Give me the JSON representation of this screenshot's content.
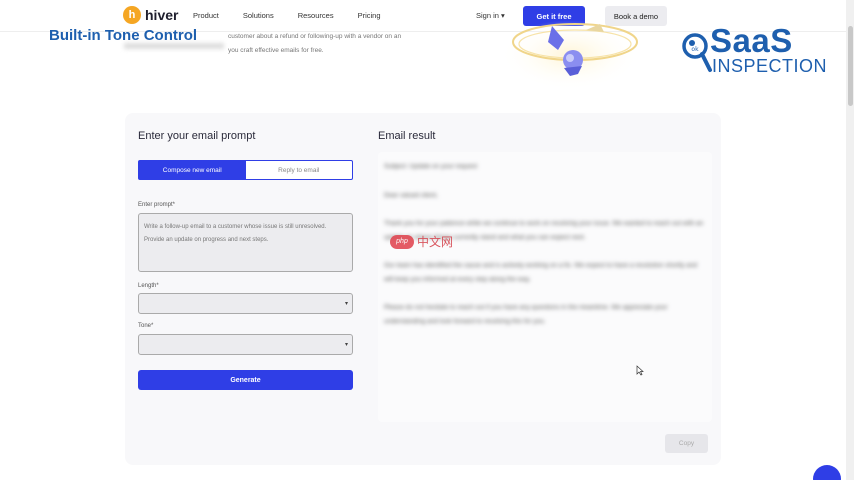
{
  "nav": {
    "logo_mark": "h",
    "logo_text": "hiver",
    "links": [
      "Product",
      "Solutions",
      "Resources",
      "Pricing"
    ],
    "signin": "Sign in",
    "cta_primary": "Get it free",
    "cta_secondary": "Book a demo"
  },
  "hero": {
    "subtitle_fragment": "customer about a refund or following-up with a vendor on an",
    "subtitle_fragment2": "you craft effective emails for free."
  },
  "overlay": {
    "title": "Built-in Tone Control",
    "watermark_big": "SaaS",
    "watermark_small": "INSPECTION",
    "php_badge": "php",
    "php_text": "中文网"
  },
  "form": {
    "heading": "Enter your email prompt",
    "tabs": [
      "Compose new email",
      "Reply to email"
    ],
    "prompt_label": "Enter prompt*",
    "prompt_placeholder_line1": "Write a follow-up email to a customer whose issue is still unresolved.",
    "prompt_placeholder_line2": "Provide an update on progress and next steps.",
    "length_label": "Length*",
    "tone_label": "Tone*",
    "generate": "Generate"
  },
  "result": {
    "heading": "Email result",
    "paragraphs": [
      "Subject: Update on your request",
      "Dear valued client,",
      "Thank you for your patience while we continue to work on resolving your issue. We wanted to reach out with an update on where things currently stand and what you can expect next.",
      "Our team has identified the cause and is actively working on a fix. We expect to have a resolution shortly and will keep you informed at every step along the way.",
      "Please do not hesitate to reach out if you have any questions in the meantime. We appreciate your understanding and look forward to resolving this for you."
    ],
    "copy": "Copy"
  },
  "colors": {
    "brand_blue": "#2f3ee6",
    "watermark_blue": "#1e5fae",
    "logo_orange": "#f5a623"
  }
}
